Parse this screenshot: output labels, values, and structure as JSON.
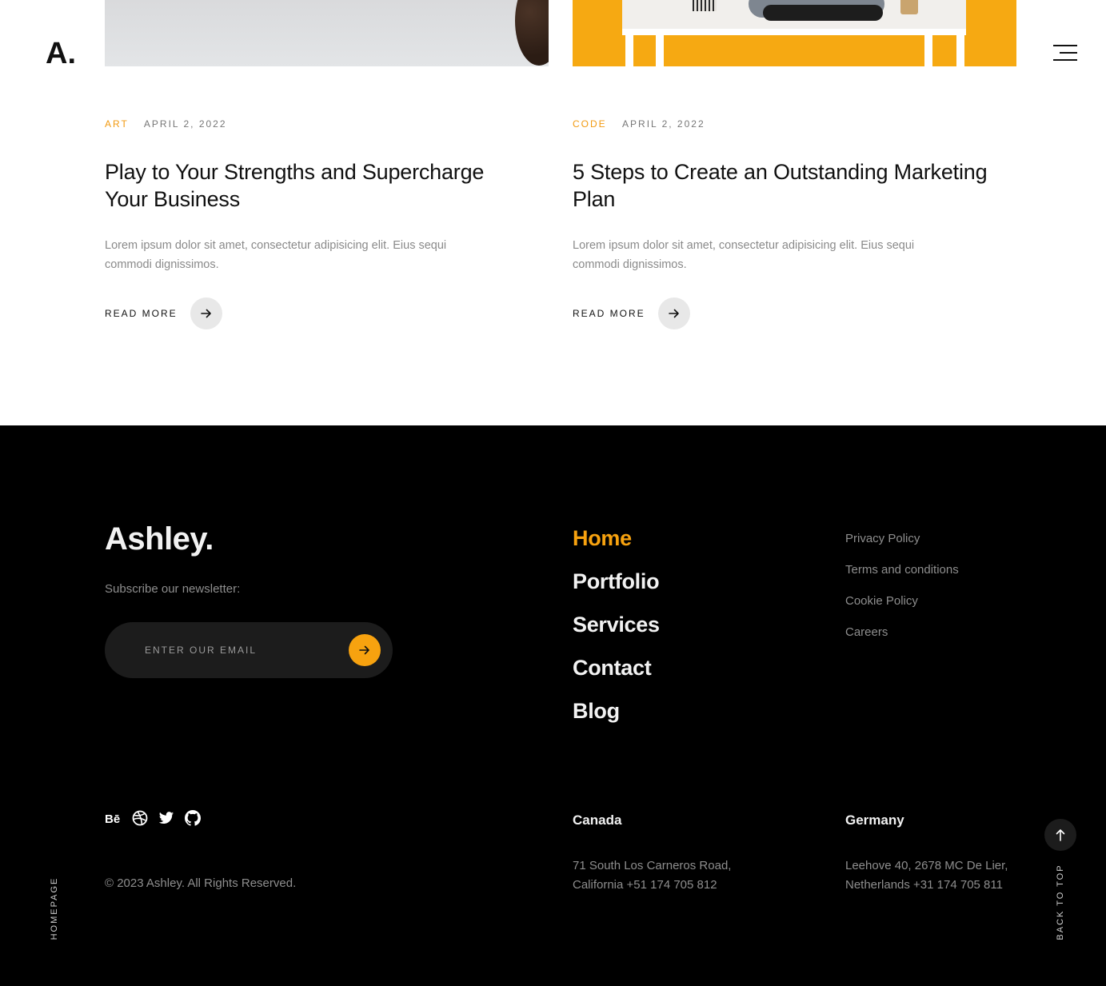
{
  "header": {
    "logo": "A.",
    "menu_icon": "hamburger-menu-icon"
  },
  "posts": [
    {
      "category": "ART",
      "date": "APRIL 2, 2022",
      "title": "Play to Your Strengths and Supercharge Your Business",
      "excerpt": "Lorem ipsum dolor sit amet, consectetur adipisicing elit. Eius sequi commodi dignissimos.",
      "read_more": "READ MORE"
    },
    {
      "category": "CODE",
      "date": "APRIL 2, 2022",
      "title": "5 Steps to Create an Outstanding Marketing Plan",
      "excerpt": "Lorem ipsum dolor sit amet, consectetur adipisicing elit. Eius sequi commodi dignissimos.",
      "read_more": "READ MORE"
    }
  ],
  "footer": {
    "brand": "Ashley.",
    "newsletter_label": "Subscribe our newsletter:",
    "email_placeholder": "ENTER OUR EMAIL",
    "nav": [
      "Home",
      "Portfolio",
      "Services",
      "Contact",
      "Blog"
    ],
    "nav_active": "Home",
    "legal": [
      "Privacy Policy",
      "Terms and conditions",
      "Cookie Policy",
      "Careers"
    ],
    "social": [
      "behance-icon",
      "dribbble-icon",
      "twitter-icon",
      "github-icon"
    ],
    "copyright": "© 2023 Ashley. All Rights Reserved.",
    "offices": [
      {
        "country": "Canada",
        "address": "71 South Los Carneros Road, California +51 174 705 812"
      },
      {
        "country": "Germany",
        "address": "Leehove 40, 2678 MC De Lier, Netherlands +31 174 705 811"
      }
    ],
    "side_label": "HOMEPAGE",
    "back_to_top": "BACK TO TOP"
  },
  "colors": {
    "accent": "#f7a20f",
    "footer_bg": "#000000",
    "muted_text": "#8e8e8e"
  }
}
